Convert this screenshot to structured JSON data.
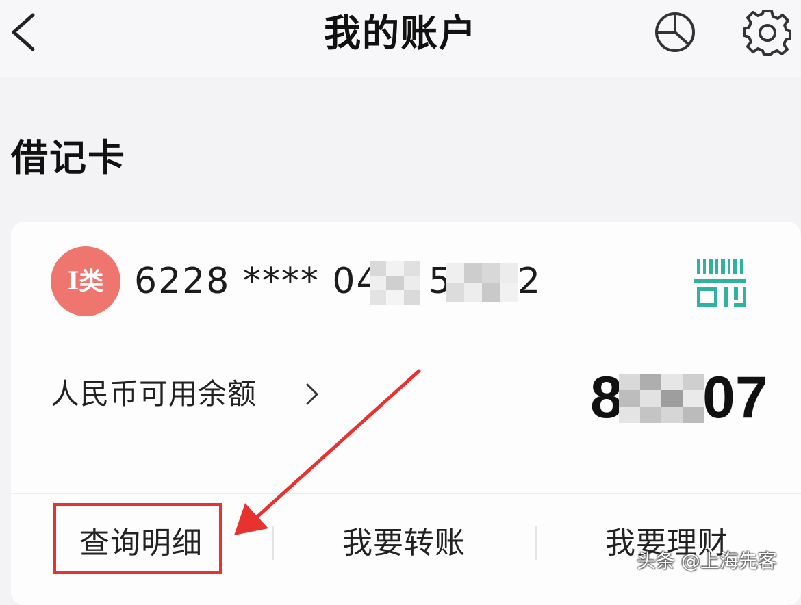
{
  "header": {
    "title": "我的账户",
    "back_icon": "chevron-left-icon",
    "stats_icon": "pie-chart-icon",
    "settings_icon": "gear-icon"
  },
  "section": {
    "title": "借记卡"
  },
  "card": {
    "badge": "I类",
    "number_visible": "6228 **** 04",
    "number_tail_fragment": "5",
    "number_end_fragment": "2",
    "qr_icon": "barcode-scan-icon",
    "balance_label": "人民币可用余额",
    "balance_prefix": "8",
    "balance_suffix": "07",
    "badge_color": "#ef766e",
    "qr_color": "#2fb39f"
  },
  "actions": [
    {
      "label": "查询明细"
    },
    {
      "label": "我要转账"
    },
    {
      "label": "我要理财"
    }
  ],
  "annotation": {
    "color": "#e8322f"
  },
  "watermark": "头条 @上海先客"
}
